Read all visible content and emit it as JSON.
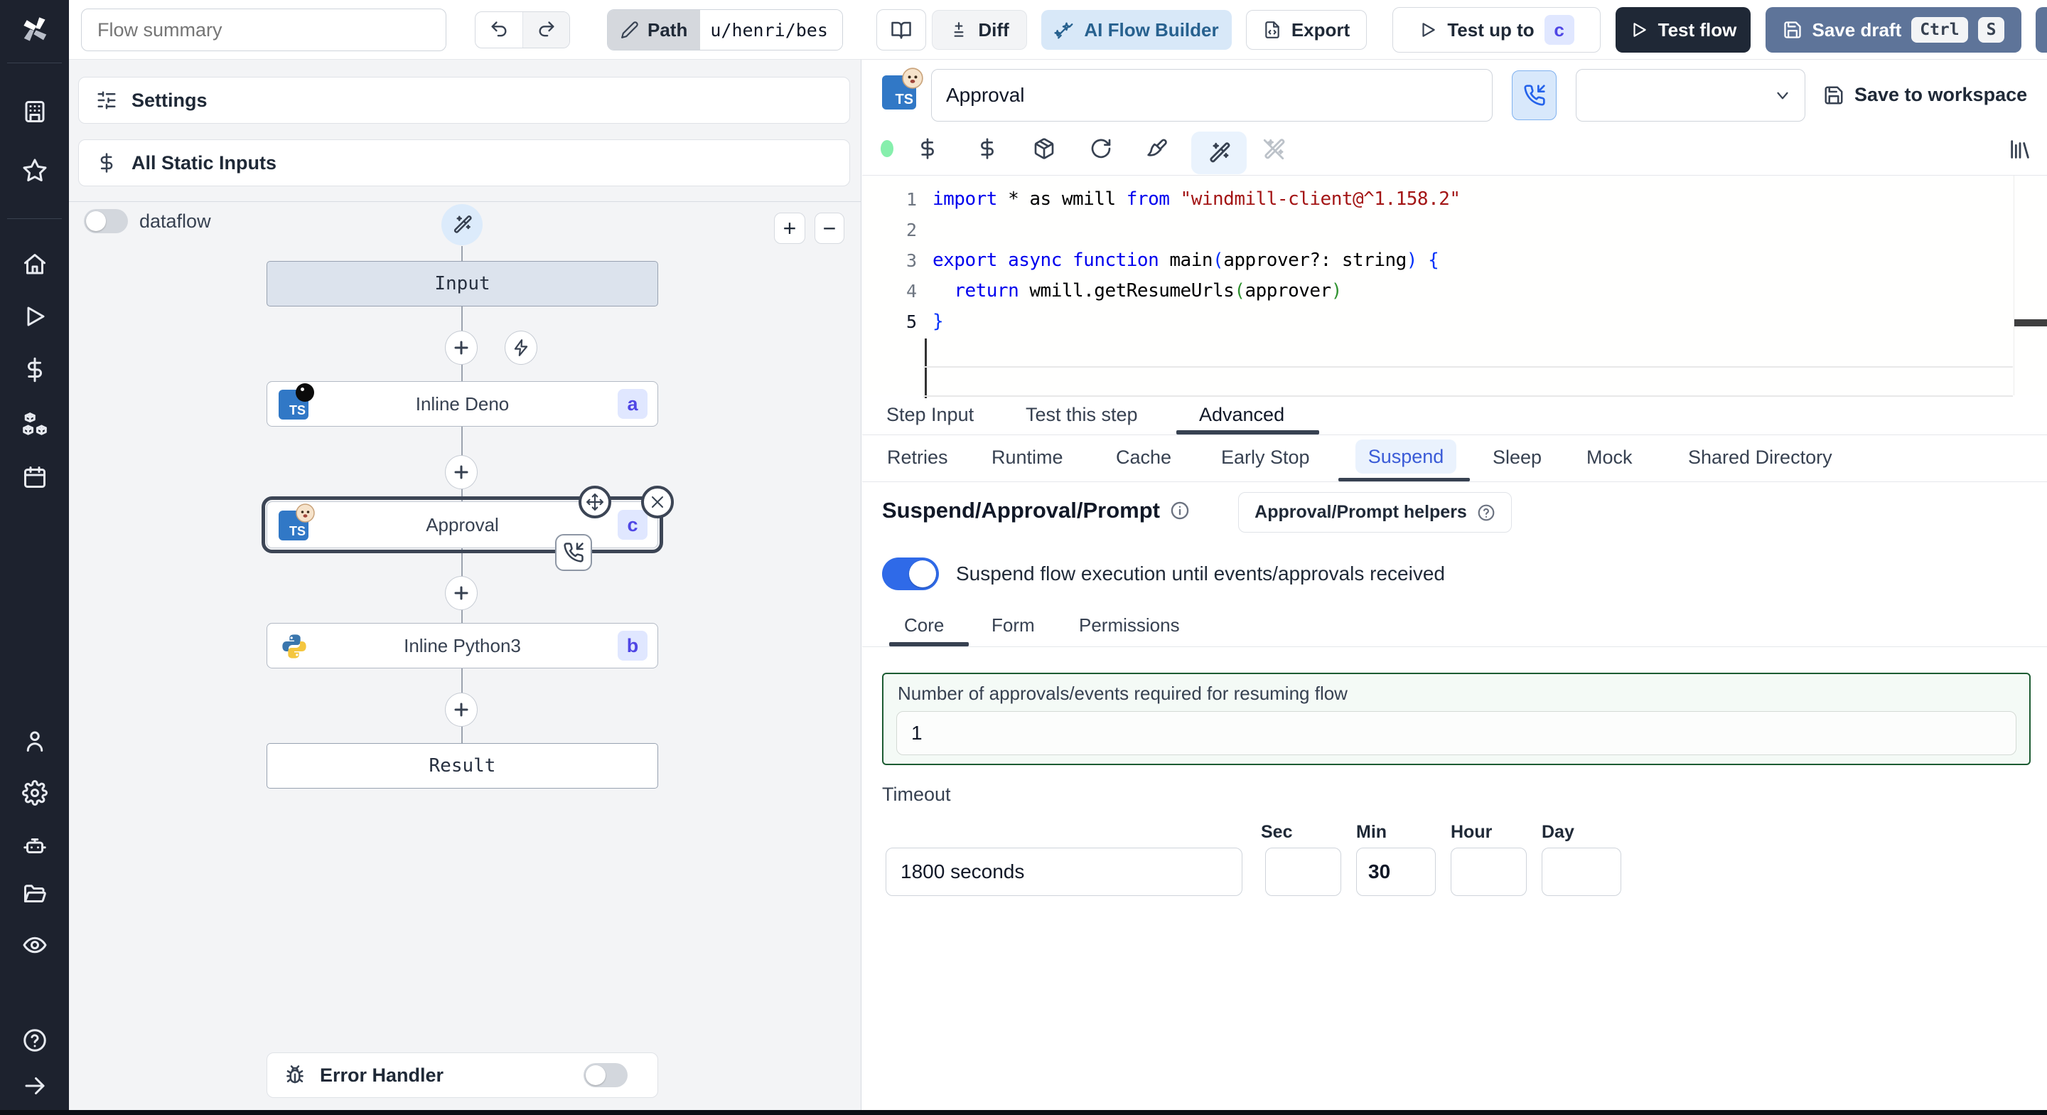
{
  "topbar": {
    "flow_summary_placeholder": "Flow summary",
    "path_label": "Path",
    "path_value": "u/henri/bes",
    "diff_label": "Diff",
    "ai_flow_builder_label": "AI Flow Builder",
    "export_label": "Export",
    "test_up_to_label": "Test up to",
    "test_up_to_badge": "c",
    "test_flow_label": "Test flow",
    "save_draft_label": "Save draft",
    "kbd_ctrl": "Ctrl",
    "kbd_s": "S"
  },
  "left_panel": {
    "settings_label": "Settings",
    "all_static_inputs_label": "All Static Inputs",
    "dataflow_label": "dataflow",
    "zoom_in_label": "+",
    "zoom_out_label": "−",
    "error_handler_label": "Error Handler"
  },
  "graph": {
    "input_label": "Input",
    "ts_badge": "TS",
    "steps": [
      {
        "label": "Inline Deno",
        "badge": "a"
      },
      {
        "label": "Approval",
        "badge": "c"
      },
      {
        "label": "Inline Python3",
        "badge": "b"
      }
    ],
    "result_label": "Result"
  },
  "step_editor": {
    "name_value": "Approval",
    "save_to_workspace_label": "Save to workspace",
    "code": {
      "line_numbers": [
        "1",
        "2",
        "3",
        "4",
        "5"
      ],
      "lines": [
        [
          {
            "t": "import",
            "c": "kw"
          },
          {
            "t": " * as wmill ",
            "c": "pl"
          },
          {
            "t": "from",
            "c": "kw"
          },
          {
            "t": " ",
            "c": "pl"
          },
          {
            "t": "\"windmill-client@^1.158.2\"",
            "c": "str"
          }
        ],
        [],
        [
          {
            "t": "export",
            "c": "kw"
          },
          {
            "t": " ",
            "c": "pl"
          },
          {
            "t": "async",
            "c": "kw"
          },
          {
            "t": " ",
            "c": "pl"
          },
          {
            "t": "function",
            "c": "kw"
          },
          {
            "t": " main",
            "c": "pl"
          },
          {
            "t": "(",
            "c": "b1"
          },
          {
            "t": "approver?: string",
            "c": "pl"
          },
          {
            "t": ")",
            "c": "b1"
          },
          {
            "t": " {",
            "c": "b1"
          }
        ],
        [
          {
            "t": "  ",
            "c": "pl"
          },
          {
            "t": "return",
            "c": "kw"
          },
          {
            "t": " wmill.getResumeUrls",
            "c": "pl"
          },
          {
            "t": "(",
            "c": "b2"
          },
          {
            "t": "approver",
            "c": "pl"
          },
          {
            "t": ")",
            "c": "b2"
          }
        ],
        [
          {
            "t": "}",
            "c": "b1"
          }
        ]
      ]
    },
    "tabs": {
      "t0": "Step Input",
      "t1": "Test this step",
      "t2": "Advanced"
    },
    "advanced_tabs": {
      "a0": "Retries",
      "a1": "Runtime",
      "a2": "Cache",
      "a3": "Early Stop",
      "a4": "Suspend",
      "a5": "Sleep",
      "a6": "Mock",
      "a7": "Shared Directory"
    },
    "suspend": {
      "title": "Suspend/Approval/Prompt",
      "helpers_label": "Approval/Prompt helpers",
      "toggle_label": "Suspend flow execution until events/approvals received",
      "tabs": {
        "c0": "Core",
        "c1": "Form",
        "c2": "Permissions"
      },
      "approvals_label": "Number of approvals/events required for resuming flow",
      "approvals_value": "1",
      "timeout_label": "Timeout",
      "timeout_value": "1800 seconds",
      "sec_label": "Sec",
      "sec_value": "",
      "min_label": "Min",
      "min_value": "30",
      "hour_label": "Hour",
      "hour_value": "",
      "day_label": "Day",
      "day_value": ""
    }
  }
}
